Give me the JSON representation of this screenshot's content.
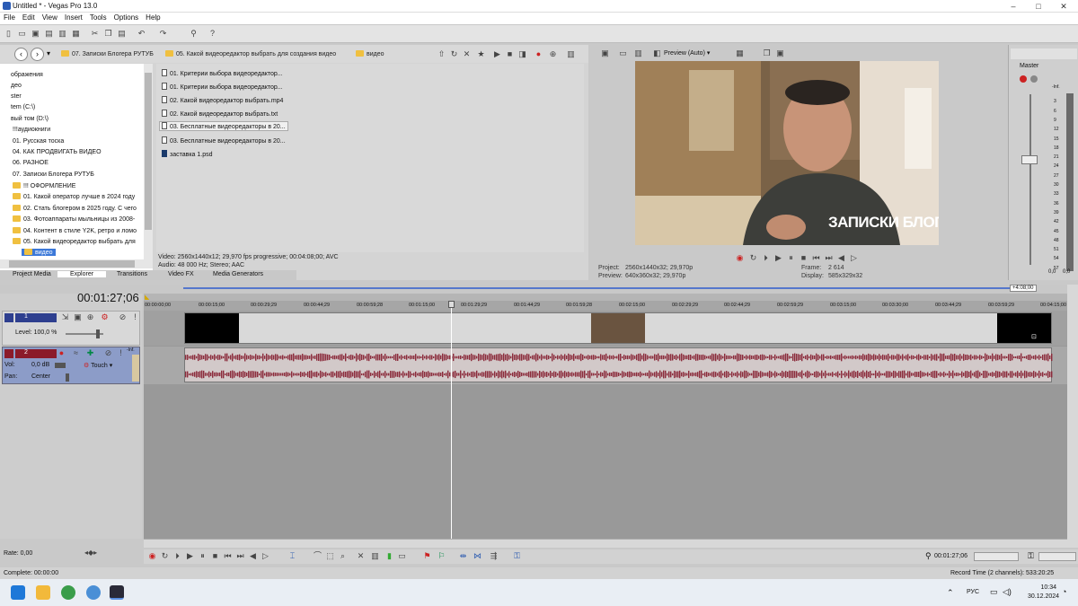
{
  "window": {
    "title": "Untitled * - Vegas Pro 13.0",
    "minimize": "–",
    "maximize": "□",
    "close": "✕"
  },
  "menu": [
    "File",
    "Edit",
    "View",
    "Insert",
    "Tools",
    "Options",
    "Help"
  ],
  "explorer": {
    "breadcrumbs": [
      "07. Записки Блогера РУТУБ",
      "05. Какой видеоредактор выбрать для создания видео",
      "видео"
    ],
    "tree": [
      "ображения",
      "део",
      "ster",
      "tem (C:\\)",
      "вый том (D:\\)",
      "!!!аудиокниги",
      "01. Русская тоска",
      "04. КАК ПРОДВИГАТЬ ВИДЕО",
      "06. РАЗНОЕ",
      "07. Записки Блогера РУТУБ",
      "!!! ОФОРМЛЕНИЕ",
      "01. Какой оператор лучше в 2024 году",
      "02. Стать блогером в 2025 году. С чего",
      "03. Фотоаппараты мыльницы из 2008-",
      "04. Контент в стиле Y2K, ретро и ломо",
      "05. Какой видеоредактор выбрать для",
      "видео"
    ],
    "files": [
      "01. Критерии выбора видеоредактор...",
      "01. Критерии выбора видеоредактор...",
      "02. Какой видеоредактор выбрать.mp4",
      "02. Какой видеоредактор выбрать.txt",
      "03. Бесплатные видеоредакторы в 20...",
      "03. Бесплатные видеоредакторы в 20...",
      "заставка 1.psd"
    ],
    "info_video": "Video: 2560x1440x12; 29,970 fps progressive; 00:04:08;00; AVC",
    "info_audio": "Audio: 48 000 Hz; Stereo; AAC",
    "tabs": [
      "Project Media",
      "Explorer",
      "Transitions",
      "Video FX",
      "Media Generators"
    ]
  },
  "preview": {
    "mode": "Preview (Auto)",
    "overlay_text": "ЗАПИСКИ БЛОГЕРА",
    "project_label": "Project:",
    "project_value": "2560x1440x32; 29,970p",
    "preview_label": "Preview:",
    "preview_value": "640x360x32; 29,970p",
    "frame_label": "Frame:",
    "frame_value": "2 614",
    "display_label": "Display:",
    "display_value": "585x329x32"
  },
  "master": {
    "label": "Master",
    "scale": [
      "-Inf.",
      "3",
      "6",
      "9",
      "12",
      "15",
      "18",
      "21",
      "24",
      "27",
      "30",
      "33",
      "36",
      "39",
      "42",
      "45",
      "48",
      "51",
      "54",
      "57"
    ],
    "levels": [
      "0,0",
      "0,0"
    ]
  },
  "timeline": {
    "timecode": "00:01:27;06",
    "end_marker": "+4:08;00",
    "ruler": [
      "00:00:00;00",
      "00:00:15;00",
      "00:00:29;29",
      "00:00:44;29",
      "00:00:59;28",
      "00:01:15;00",
      "00:01:29;29",
      "00:01:44;29",
      "00:01:59;28",
      "00:02:15;00",
      "00:02:29;29",
      "00:02:44;29",
      "00:02:59;29",
      "00:03:15;00",
      "00:03:30;00",
      "00:03:44;29",
      "00:03:59;29",
      "00:04:15;00"
    ],
    "video_track": {
      "number": "1",
      "level": "Level: 100,0 %"
    },
    "audio_track": {
      "number": "2",
      "vol_label": "Vol:",
      "vol_value": "0,0 dB",
      "pan_label": "Pan:",
      "pan_value": "Center",
      "mode": "Touch",
      "meter_top": "-Inf."
    }
  },
  "transport": {
    "rate": "Rate: 0,00",
    "cursor_time": "00:01:27;06",
    "record_time": "Record Time (2 channels): 533:20:25"
  },
  "status": {
    "complete": "Complete: 00:00:00"
  },
  "taskbar": {
    "lang": "РУС",
    "time": "10:34",
    "date": "30.12.2024"
  },
  "colors": {
    "accent": "#3b78d8",
    "audio_wave": "#8b2a3a",
    "track_video": "#2e3f8f",
    "track_audio": "#8b1a2a"
  }
}
